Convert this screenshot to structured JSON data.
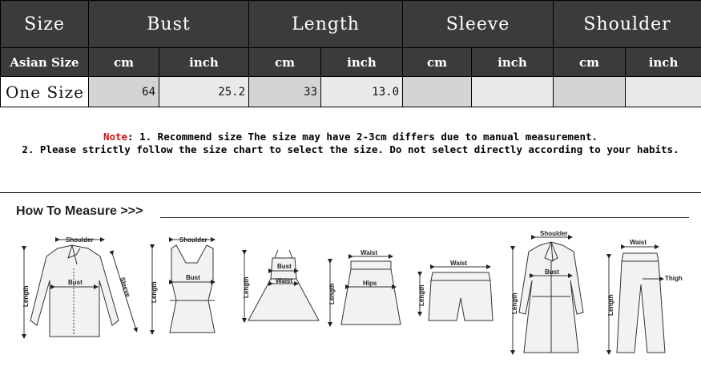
{
  "table": {
    "headers": [
      "Size",
      "Bust",
      "Length",
      "Sleeve",
      "Shoulder"
    ],
    "subheaders": [
      "Asian Size",
      "cm",
      "inch",
      "cm",
      "inch",
      "cm",
      "inch",
      "cm",
      "inch"
    ],
    "row": [
      "One Size",
      "64",
      "25.2",
      "33",
      "13.0",
      "",
      "",
      "",
      ""
    ]
  },
  "note": {
    "label": "Note",
    "line1": ": 1. Recommend size  The size may have 2-3cm differs due to manual measurement.",
    "line2": "2. Please strictly follow the size chart to select the size. Do not select directly according to your habits."
  },
  "measure": {
    "title": "How To Measure >>>",
    "labels": {
      "shoulder": "Shoulder",
      "bust": "Bust",
      "length": "Length",
      "sleeve": "Sleeve",
      "waist": "Waist",
      "hips": "Hips",
      "thigh": "Thigh"
    }
  }
}
